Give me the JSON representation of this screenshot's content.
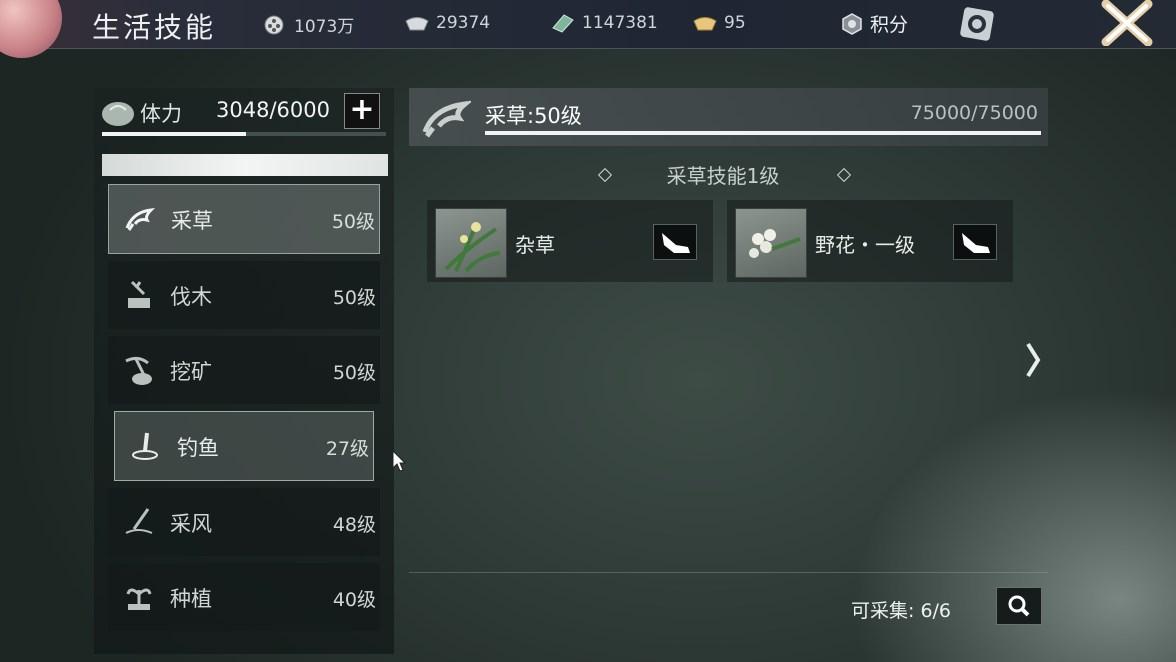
{
  "header": {
    "title": "生活技能",
    "resources": [
      {
        "icon": "film-reel-icon",
        "value": "1073万"
      },
      {
        "icon": "silver-ingot-icon",
        "value": "29374"
      },
      {
        "icon": "jade-icon",
        "value": "1147381"
      },
      {
        "icon": "gold-ingot-icon",
        "value": "95"
      }
    ],
    "points_label": "积分"
  },
  "stamina": {
    "label": "体力",
    "value": "3048/6000",
    "fill_fraction": 0.508
  },
  "skills": [
    {
      "name": "采草",
      "level": "50级",
      "icon": "herb-gathering-icon"
    },
    {
      "name": "伐木",
      "level": "50级",
      "icon": "logging-icon"
    },
    {
      "name": "挖矿",
      "level": "50级",
      "icon": "mining-icon"
    },
    {
      "name": "钓鱼",
      "level": "27级",
      "icon": "fishing-icon"
    },
    {
      "name": "采风",
      "level": "48级",
      "icon": "wind-collect-icon"
    },
    {
      "name": "种植",
      "level": "40级",
      "icon": "planting-icon"
    }
  ],
  "detail": {
    "title": "采草:50级",
    "exp": "75000/75000",
    "exp_fraction": 1.0,
    "section_title": "采草技能1级",
    "items": [
      {
        "name": "杂草",
        "icon": "weed-icon"
      },
      {
        "name": "野花・一级",
        "icon": "wildflower-icon"
      }
    ],
    "collectable": "可采集:  6/6"
  }
}
